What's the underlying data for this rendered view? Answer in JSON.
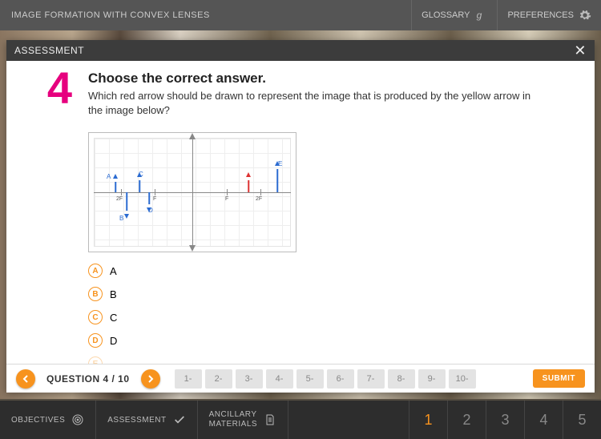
{
  "topbar": {
    "title": "IMAGE FORMATION WITH CONVEX LENSES",
    "glossary": "GLOSSARY",
    "preferences": "PREFERENCES"
  },
  "modal": {
    "header": "ASSESSMENT",
    "question_number": "4",
    "instruction": "Choose the correct answer.",
    "prompt": "Which red arrow should be drawn to represent the image that is produced by the yellow arrow in the image below?",
    "diagram_labels": {
      "A": "A",
      "B": "B",
      "C": "C",
      "D": "D",
      "E": "E",
      "F": "F",
      "2F": "2F"
    },
    "options": [
      {
        "letter": "A",
        "text": "A"
      },
      {
        "letter": "B",
        "text": "B"
      },
      {
        "letter": "C",
        "text": "C"
      },
      {
        "letter": "D",
        "text": "D"
      },
      {
        "letter": "E",
        "text": "E"
      }
    ]
  },
  "nav": {
    "label": "QUESTION 4 / 10",
    "slots": [
      "1-",
      "2-",
      "3-",
      "4-",
      "5-",
      "6-",
      "7-",
      "8-",
      "9-",
      "10-"
    ],
    "submit": "SUBMIT"
  },
  "bottombar": {
    "objectives": "OBJECTIVES",
    "assessment": "ASSESSMENT",
    "ancillary": "ANCILLARY\nMATERIALS",
    "pages": [
      "1",
      "2",
      "3",
      "4",
      "5"
    ],
    "active_page": 0
  }
}
